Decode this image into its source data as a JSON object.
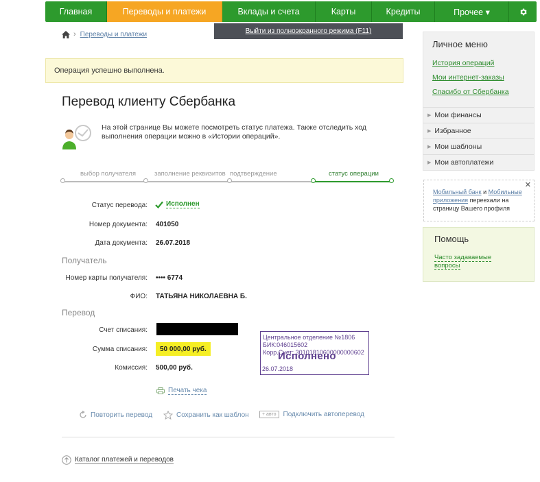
{
  "nav": {
    "items": [
      {
        "label": "Главная"
      },
      {
        "label": "Переводы и платежи"
      },
      {
        "label": "Вклады и счета"
      },
      {
        "label": "Карты"
      },
      {
        "label": "Кредиты"
      },
      {
        "label": "Прочее ▾"
      }
    ],
    "settings_icon": "gear-icon",
    "active_color": "#f6a623",
    "brand_color": "#2d9a2d"
  },
  "fullscreen_exit": "Выйти из полноэкранного режима (F11)",
  "breadcrumb": {
    "item": "Переводы и платежи"
  },
  "success_message": "Операция успешно выполнена.",
  "page_title": "Перевод клиенту Сбербанка",
  "info_text": "На этой странице Вы можете посмотреть статус платежа. Также отследить ход выполнения операции можно в «Истории операций».",
  "steps": [
    "выбор получателя",
    "заполнение реквизитов",
    "подтверждение",
    "статус операции"
  ],
  "details": {
    "status_label": "Статус перевода:",
    "status_value": "Исполнен",
    "doc_number_label": "Номер документа:",
    "doc_number_value": "401050",
    "doc_date_label": "Дата документа:",
    "doc_date_value": "26.07.2018",
    "recipient_section": "Получатель",
    "card_label": "Номер карты получателя:",
    "card_value": "•••• 6774",
    "fio_label": "ФИО:",
    "fio_value": "ТАТЬЯНА НИКОЛАЕВНА Б.",
    "transfer_section": "Перевод",
    "account_label": "Счет списания:",
    "amount_label": "Сумма списания:",
    "amount_value": "50 000,00 руб.",
    "commission_label": "Комиссия:",
    "commission_value": "500,00 руб."
  },
  "stamp": {
    "line1": "Центральное отделение №1806",
    "line2": "БИК:046015602",
    "line3": "Корр.Счет: 30101810600000000602",
    "status": "Исполнено",
    "date": "26.07.2018"
  },
  "print_link": "Печать чека",
  "actions": {
    "repeat": "Повторить перевод",
    "save_template": "Сохранить как шаблон",
    "auto_tag": "+ авто",
    "autopay": "Подключить автоперевод"
  },
  "catalog_link": "Каталог платежей и переводов",
  "sidebar": {
    "personal_title": "Личное меню",
    "links": [
      "История операций",
      "Мои интернет-заказы",
      "Спасибо от Сбербанка"
    ],
    "menu": [
      "Мои финансы",
      "Избранное",
      "Мои шаблоны",
      "Мои автоплатежи"
    ],
    "notice": {
      "part1": "Мобильный банк",
      "part2": " и ",
      "part3": "Мобильные приложения",
      "part4": " переехали на страницу Вашего профиля"
    },
    "help_title": "Помощь",
    "help_link": "Часто задаваемые вопросы"
  }
}
